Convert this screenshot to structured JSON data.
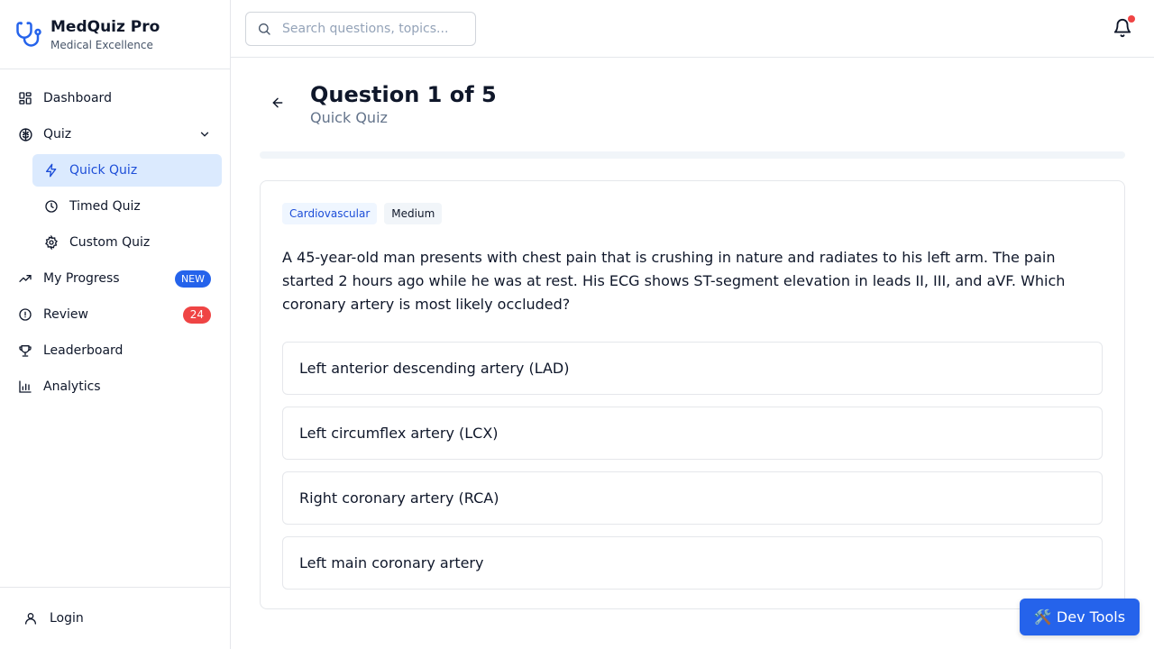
{
  "brand": {
    "name": "MedQuiz Pro",
    "tagline": "Medical Excellence"
  },
  "sidebar": {
    "items": [
      {
        "label": "Dashboard",
        "icon": "dashboard-icon"
      },
      {
        "label": "Quiz",
        "icon": "brain-icon"
      },
      {
        "label": "Quick Quiz",
        "icon": "zap-icon",
        "active": true
      },
      {
        "label": "Timed Quiz",
        "icon": "clock-icon"
      },
      {
        "label": "Custom Quiz",
        "icon": "gear-icon"
      },
      {
        "label": "My Progress",
        "icon": "trending-up-icon",
        "badge": "NEW"
      },
      {
        "label": "Review",
        "icon": "alert-circle-icon",
        "badge": "24"
      },
      {
        "label": "Leaderboard",
        "icon": "trophy-icon"
      },
      {
        "label": "Analytics",
        "icon": "bar-chart-icon"
      }
    ],
    "footer": {
      "label": "Login",
      "icon": "user-icon"
    }
  },
  "header": {
    "search_placeholder": "Search questions, topics..."
  },
  "quiz": {
    "title": "Question 1 of 5",
    "subtitle": "Quick Quiz",
    "progress": 0,
    "category": "Cardiovascular",
    "difficulty": "Medium",
    "question": "A 45-year-old man presents with chest pain that is crushing in nature and radiates to his left arm. The pain started 2 hours ago while he was at rest. His ECG shows ST-segment elevation in leads II, III, and aVF. Which coronary artery is most likely occluded?",
    "options": [
      "Left anterior descending artery (LAD)",
      "Left circumflex artery (LCX)",
      "Right coronary artery (RCA)",
      "Left main coronary artery"
    ]
  },
  "devtools": {
    "label": "🛠️ Dev Tools"
  },
  "colors": {
    "accent": "#2563eb",
    "badge_red": "#ef4444",
    "active_bg": "#dbeafe"
  }
}
